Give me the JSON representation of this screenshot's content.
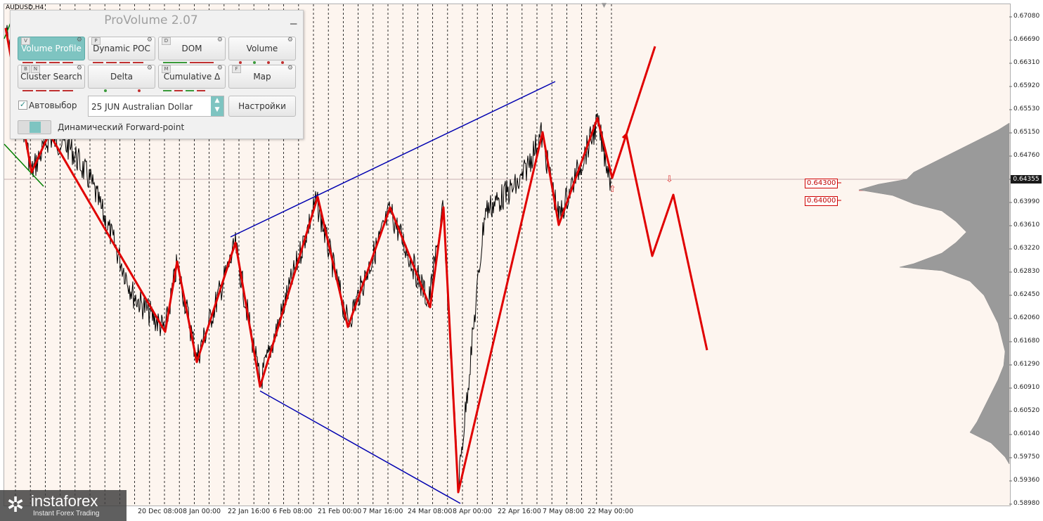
{
  "symbol": "AUDUSD,H4",
  "panel": {
    "title": "ProVolume 2.07",
    "buttons": [
      {
        "label": "Volume Profile",
        "key": "V",
        "active": true
      },
      {
        "label": "Dynamic POC",
        "key": "P",
        "active": false
      },
      {
        "label": "DOM",
        "key": "D",
        "active": false
      },
      {
        "label": "Volume",
        "key": "",
        "active": false
      },
      {
        "label": "Cluster Search",
        "key": "B",
        "key2": "N",
        "active": false
      },
      {
        "label": "Delta",
        "key": "",
        "active": false
      },
      {
        "label": "Cumulative Δ",
        "key": "M",
        "active": false
      },
      {
        "label": "Map",
        "key": "F",
        "active": false
      }
    ],
    "autoselect_label": "Автовыбор",
    "autoselect_checked": true,
    "contract_value": "25 JUN Australian Dollar",
    "settings_label": "Настройки",
    "forward_label": "Динамический Forward-point",
    "accent_color": "#7ec4c1"
  },
  "price_axis": [
    "0.67080",
    "0.66690",
    "0.66310",
    "0.65920",
    "0.65530",
    "0.65150",
    "0.64760",
    "0.64355",
    "0.63990",
    "0.63610",
    "0.63220",
    "0.62830",
    "0.62450",
    "0.62060",
    "0.61680",
    "0.61290",
    "0.60910",
    "0.60520",
    "0.60140",
    "0.59750",
    "0.59360",
    "0.58980"
  ],
  "current_price": "0.64355",
  "level_labels": [
    "0.64300",
    "0.64000"
  ],
  "time_axis": [
    "20 Dec 08:00",
    "8 Jan 00:00",
    "22 Jan 16:00",
    "6 Feb 08:00",
    "21 Feb 00:00",
    "7 Mar 16:00",
    "24 Mar 08:00",
    "8 Apr 00:00",
    "22 Apr 16:00",
    "7 May 08:00",
    "22 May 00:00"
  ],
  "logo": {
    "brand": "instaforex",
    "tagline": "Instant Forex Trading"
  },
  "colors": {
    "zigzag": "#e00000",
    "channel": "#0000b0",
    "trend": "#008000",
    "background": "#fdf5ef"
  }
}
